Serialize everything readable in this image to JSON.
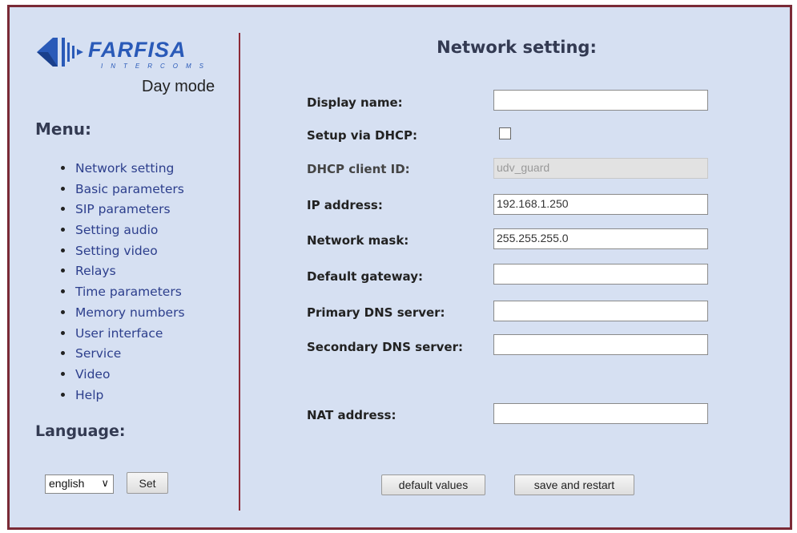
{
  "sidebar": {
    "logo": {
      "brand": "FARFISA",
      "tagline": "INTERCOMS"
    },
    "mode": "Day mode",
    "menu_title": "Menu:",
    "menu_items": [
      {
        "label": "Network setting"
      },
      {
        "label": "Basic parameters"
      },
      {
        "label": "SIP parameters"
      },
      {
        "label": "Setting audio"
      },
      {
        "label": "Setting video"
      },
      {
        "label": "Relays"
      },
      {
        "label": "Time parameters"
      },
      {
        "label": "Memory numbers"
      },
      {
        "label": "User interface"
      },
      {
        "label": "Service"
      },
      {
        "label": "Video"
      },
      {
        "label": "Help"
      }
    ],
    "language_title": "Language:",
    "language_value": "english",
    "set_label": "Set"
  },
  "main": {
    "title": "Network setting:",
    "fields": {
      "display_name": {
        "label": "Display name:",
        "value": ""
      },
      "setup_dhcp": {
        "label": "Setup via DHCP:",
        "checked": false
      },
      "dhcp_client_id": {
        "label": "DHCP client ID:",
        "value": "udv_guard"
      },
      "ip_address": {
        "label": "IP address:",
        "value": "192.168.1.250"
      },
      "network_mask": {
        "label": "Network mask:",
        "value": "255.255.255.0"
      },
      "default_gateway": {
        "label": "Default gateway:",
        "value": ""
      },
      "primary_dns": {
        "label": "Primary DNS server:",
        "value": ""
      },
      "secondary_dns": {
        "label": "Secondary DNS server:",
        "value": ""
      },
      "nat_address": {
        "label": "NAT address:",
        "value": ""
      }
    },
    "default_values_label": "default values",
    "save_restart_label": "save and restart"
  },
  "colors": {
    "frame": "#7a2a36",
    "panel": "#d6e0f2",
    "link": "#2c3e8c",
    "heading": "#333a52",
    "logo": "#2a5ab8"
  },
  "icons": {
    "logo_mark": "farfisa-logo-icon",
    "dropdown": "chevron-down-icon"
  }
}
